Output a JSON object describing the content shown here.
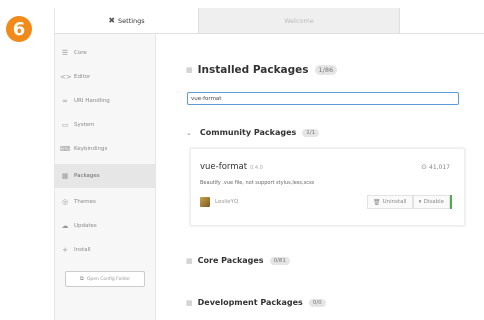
{
  "step_badge": "6",
  "tabs": [
    {
      "label": "Settings",
      "icon": "settings-icon",
      "active": true
    },
    {
      "label": "Welcome",
      "active": false
    }
  ],
  "sidebar": {
    "items": [
      {
        "label": "Core",
        "icon": "list-icon"
      },
      {
        "label": "Editor",
        "icon": "code-icon"
      },
      {
        "label": "URI Handling",
        "icon": "link-icon"
      },
      {
        "label": "System",
        "icon": "monitor-icon"
      },
      {
        "label": "Keybindings",
        "icon": "keyboard-icon"
      },
      {
        "label": "Packages",
        "icon": "package-icon",
        "active": true
      },
      {
        "label": "Themes",
        "icon": "paintcan-icon"
      },
      {
        "label": "Updates",
        "icon": "cloud-download-icon"
      },
      {
        "label": "Install",
        "icon": "plus-icon"
      }
    ],
    "open_config_label": "Open Config Folder"
  },
  "main": {
    "installed": {
      "title": "Installed Packages",
      "count": "1/86"
    },
    "search": {
      "value": "vue-format",
      "placeholder": ""
    },
    "community": {
      "title": "Community Packages",
      "count": "1/1"
    },
    "package": {
      "name": "vue-format",
      "version": "0.4.0",
      "downloads": "41,017",
      "description": "Beautify .vue file, not support stylus,less,scss",
      "author": "LeslieYQ",
      "uninstall_label": "Uninstall",
      "disable_label": "Disable"
    },
    "core": {
      "title": "Core Packages",
      "count": "0/81"
    },
    "dev": {
      "title": "Development Packages",
      "count": "0/0"
    }
  },
  "colors": {
    "accent": "#5d9bd9",
    "step_badge": "#f28a1a",
    "enabled": "#4cae4c"
  }
}
